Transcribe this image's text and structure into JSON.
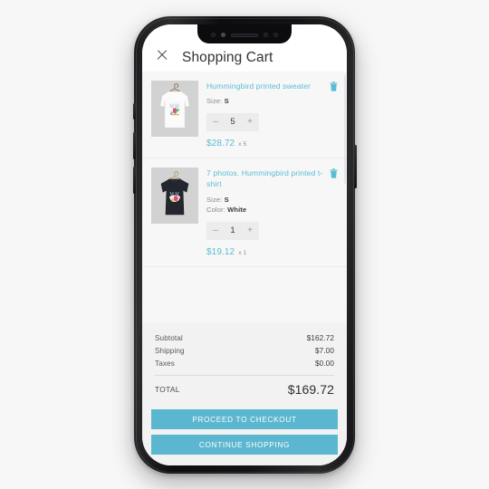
{
  "device": {
    "notch": {
      "sensor_left_icon": "proximity-sensor-icon",
      "camera_icon": "front-camera-icon",
      "speaker_icon": "earpiece-speaker-icon",
      "sensor_right_icon": "infrared-sensor-icon",
      "dot_projector_icon": "dot-projector-icon"
    },
    "buttons": {
      "silent_switch": "silent-switch",
      "volume_up": "volume-up",
      "volume_down": "volume-down",
      "power": "power"
    }
  },
  "header": {
    "close_icon": "close-icon",
    "title": "Shopping Cart"
  },
  "cart": {
    "items": [
      {
        "name": "Hummingbird printed sweater",
        "thumbnail_icon": "white-long-sleeve-sweater-thumbnail",
        "delete_icon": "trash-icon",
        "size_label": "Size:",
        "size_value": "S",
        "quantity": "5",
        "decrement_label": "–",
        "increment_label": "+",
        "price": "$28.72",
        "quantity_multiplier": "x 5"
      },
      {
        "name": "7 photos. Hummingbird printed t-shirt",
        "thumbnail_icon": "black-tshirt-thumbnail",
        "delete_icon": "trash-icon",
        "size_label": "Size:",
        "size_value": "S",
        "color_label": "Color:",
        "color_value": "White",
        "quantity": "1",
        "decrement_label": "–",
        "increment_label": "+",
        "price": "$19.12",
        "quantity_multiplier": "x 1"
      }
    ]
  },
  "summary": {
    "rows": [
      {
        "label": "Subtotal",
        "value": "$162.72"
      },
      {
        "label": "Shipping",
        "value": "$7.00"
      },
      {
        "label": "Taxes",
        "value": "$0.00"
      }
    ],
    "total_label": "TOTAL",
    "total_value": "$169.72"
  },
  "actions": {
    "checkout_label": "PROCEED TO CHECKOUT",
    "continue_label": "CONTINUE SHOPPING"
  },
  "colors": {
    "accent": "#5bb7d0",
    "link": "#5bbcd6",
    "screen_bg": "#f7f7f7",
    "summary_bg": "#f2f2f2",
    "page_bg": "#f7f7f8"
  }
}
